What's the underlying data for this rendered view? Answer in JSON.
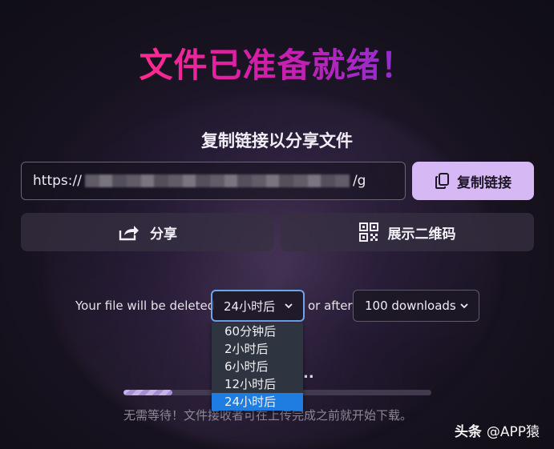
{
  "header": {
    "title": "文件已准备就绪！"
  },
  "share_section": {
    "subtitle": "复制链接以分享文件",
    "url_prefix": "https://",
    "url_suffix": "/g",
    "copy_label": "复制链接",
    "share_label": "分享",
    "qr_label": "展示二维码"
  },
  "expiry": {
    "prefix": "Your file will be deleted",
    "time_selected": "24小时后",
    "connector": "or after",
    "downloads_selected": "100 downloads",
    "time_options": [
      "60分钟后",
      "2小时后",
      "6小时后",
      "12小时后",
      "24小时后"
    ]
  },
  "upload": {
    "dots": "..",
    "progress": 0.16,
    "note": "无需等待！文件接收者可在上传完成之前就开始下载。"
  },
  "watermark": {
    "brand": "头条",
    "handle": "@APP猿"
  },
  "colors": {
    "accent_button": "#d6b8f5",
    "dropdown_selected": "#1f7ce0",
    "title_gradient_start": "#ff2a8e",
    "title_gradient_end": "#8a2fd6"
  },
  "icons": {
    "copy": "copy-icon",
    "share": "share-icon",
    "qr": "qr-code-icon",
    "chevron": "chevron-down-icon"
  }
}
